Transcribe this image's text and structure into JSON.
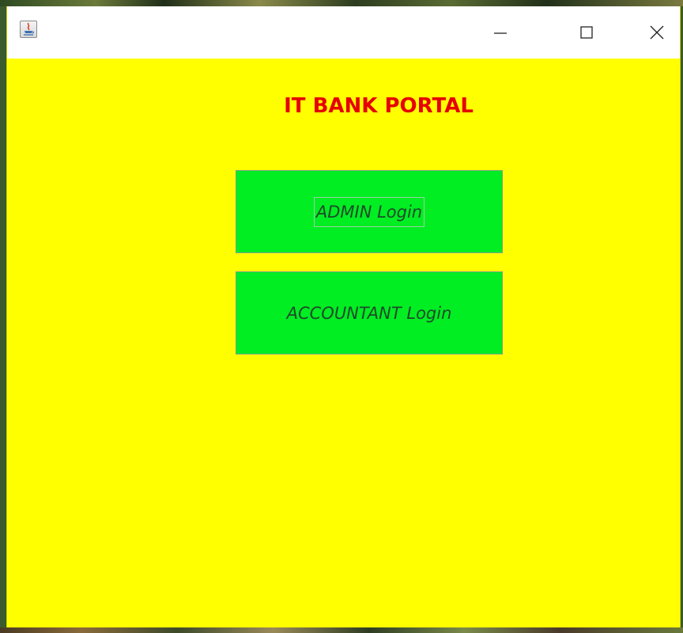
{
  "window": {
    "title": "",
    "icon": "java-app-icon",
    "controls": [
      "minimize-icon",
      "maximize-icon",
      "close-icon"
    ]
  },
  "colors": {
    "background": "#ffff00",
    "title_text": "#e60000",
    "button_fill": "#00ee22",
    "button_text": "#1e4a2a"
  },
  "main": {
    "heading": "IT BANK PORTAL",
    "buttons": {
      "admin_label": "ADMIN Login",
      "accountant_label": "ACCOUNTANT Login"
    }
  }
}
